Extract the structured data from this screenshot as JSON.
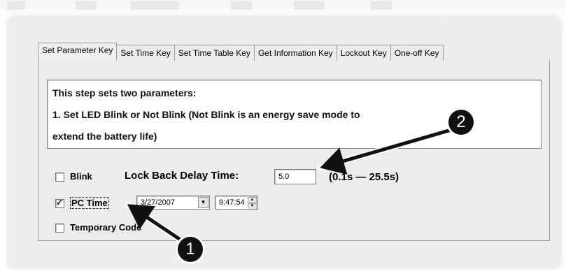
{
  "tabs": [
    {
      "label": "Set Parameter Key",
      "active": true
    },
    {
      "label": "Set Time Key",
      "active": false
    },
    {
      "label": "Set Time Table Key",
      "active": false
    },
    {
      "label": "Get Information Key",
      "active": false
    },
    {
      "label": "Lockout Key",
      "active": false
    },
    {
      "label": "One-off Key",
      "active": false
    }
  ],
  "description": {
    "line1": "This step sets two parameters:",
    "line2": "1. Set LED Blink or Not Blink (Not Blink is an energy save mode to",
    "line3": "extend the battery life)"
  },
  "blink": {
    "label": "Blink",
    "checked": false
  },
  "lock_back": {
    "label": "Lock Back Delay Time:",
    "value": "5.0",
    "range": "(0.1s — 25.5s)"
  },
  "pc_time": {
    "label": "PC Time",
    "checked": true,
    "date": "3/27/2007",
    "time": "9:47:54"
  },
  "temporary_code": {
    "label": "Temporary Code",
    "checked": false
  },
  "annotations": {
    "badge1": "1",
    "badge2": "2"
  },
  "colors": {
    "panel": "#ececec",
    "arrow": "#111111"
  }
}
